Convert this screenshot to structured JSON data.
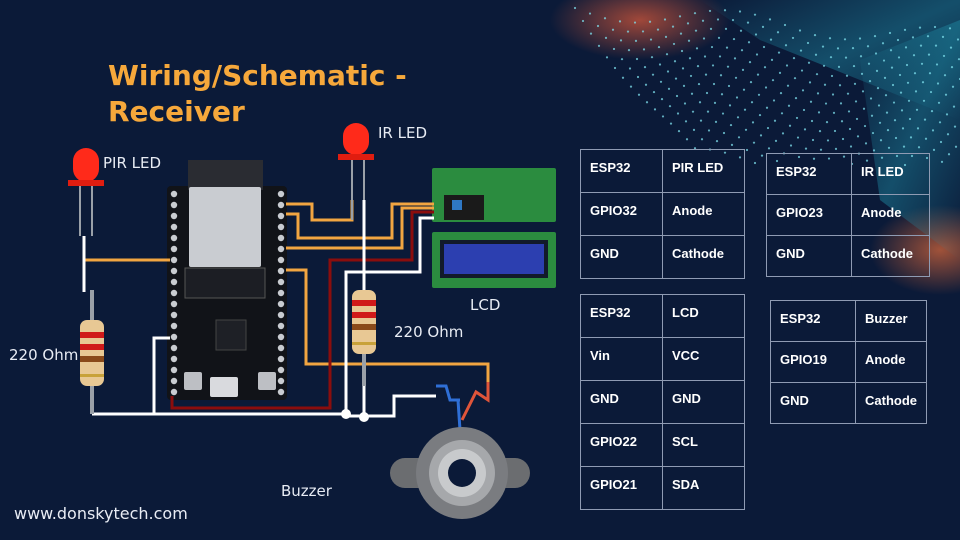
{
  "title": {
    "line1": "Wiring/Schematic -",
    "line2": "Receiver"
  },
  "labels": {
    "pir_led": "PIR LED",
    "ir_led": "IR LED",
    "lcd": "LCD",
    "resistor_left": "220 Ohm",
    "resistor_right": "220 Ohm",
    "buzzer": "Buzzer"
  },
  "footer": "www.donskytech.com",
  "colors": {
    "background": "#0b1a38",
    "title": "#f6a83b",
    "wire_signal": "#f2a541",
    "wire_power": "#8b0d0d",
    "wire_ground": "#ffffff",
    "led": "#ff2a1a",
    "table_border": "#8f9bb3"
  },
  "tables": {
    "pir_led": {
      "header": [
        "ESP32",
        "PIR LED"
      ],
      "rows": [
        [
          "GPIO32",
          "Anode"
        ],
        [
          "GND",
          "Cathode"
        ]
      ]
    },
    "ir_led": {
      "header": [
        "ESP32",
        "IR LED"
      ],
      "rows": [
        [
          "GPIO23",
          "Anode"
        ],
        [
          "GND",
          "Cathode"
        ]
      ]
    },
    "lcd": {
      "header": [
        "ESP32",
        "LCD"
      ],
      "rows": [
        [
          "Vin",
          "VCC"
        ],
        [
          "GND",
          "GND"
        ],
        [
          "GPIO22",
          "SCL"
        ],
        [
          "GPIO21",
          "SDA"
        ]
      ]
    },
    "buzzer": {
      "header": [
        "ESP32",
        "Buzzer"
      ],
      "rows": [
        [
          "GPIO19",
          "Anode"
        ],
        [
          "GND",
          "Cathode"
        ]
      ]
    }
  }
}
